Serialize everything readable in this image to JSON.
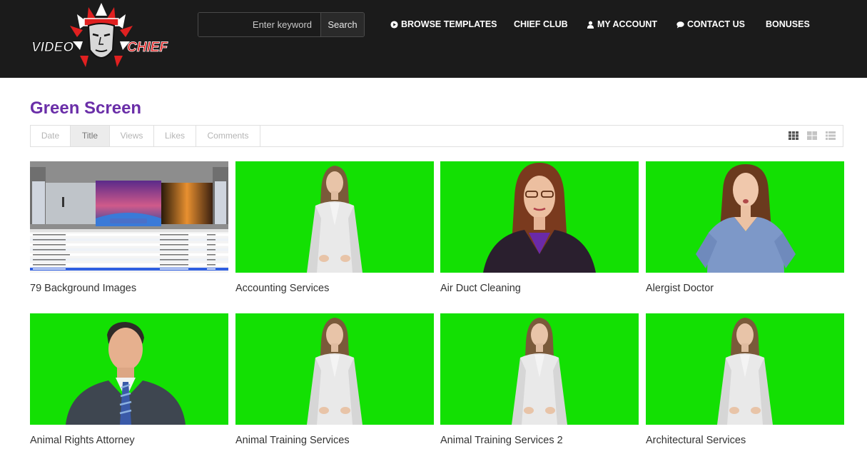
{
  "header": {
    "logo_left": "VIDEO",
    "logo_right": "CHIEF",
    "search": {
      "placeholder": "Enter keyword",
      "button_label": "Search"
    },
    "nav": [
      {
        "label": "BROWSE TEMPLATES",
        "icon": "play-circle-icon"
      },
      {
        "label": "CHIEF CLUB",
        "icon": ""
      },
      {
        "label": "MY ACCOUNT",
        "icon": "user-icon"
      },
      {
        "label": "CONTACT US",
        "icon": "chat-icon"
      },
      {
        "label": "BONUSES",
        "icon": ""
      }
    ]
  },
  "page": {
    "title": "Green Screen"
  },
  "sort": {
    "tabs": [
      "Date",
      "Title",
      "Views",
      "Likes",
      "Comments"
    ],
    "active": "Title",
    "views": [
      "grid-small-icon",
      "grid-large-icon",
      "list-icon"
    ]
  },
  "colors": {
    "green_screen": "#13e003",
    "title": "#6a2ea8",
    "header_bg": "#1b1b1b"
  },
  "items": [
    {
      "title": "79 Background Images",
      "thumb": "file-browser-screenshot"
    },
    {
      "title": "Accounting Services",
      "thumb": "woman-white-jacket"
    },
    {
      "title": "Air Duct Cleaning",
      "thumb": "woman-dark-jacket-glasses"
    },
    {
      "title": "Alergist Doctor",
      "thumb": "woman-blue-scrubs"
    },
    {
      "title": "Animal Rights Attorney",
      "thumb": "man-suit"
    },
    {
      "title": "Animal Training Services",
      "thumb": "woman-white-jacket"
    },
    {
      "title": "Animal Training Services 2",
      "thumb": "woman-white-jacket"
    },
    {
      "title": "Architectural Services",
      "thumb": "woman-white-jacket"
    }
  ],
  "file_list": {
    "caption": "motion background (107).jpg",
    "rows": [
      "background (271).jpg",
      "background (323).jpg",
      "background (14).jpg",
      "background (214).jpg",
      "background (41) (sunrise).jpg",
      "background (39).jpg",
      "background (155).jpg",
      "background (107).jpg"
    ]
  }
}
